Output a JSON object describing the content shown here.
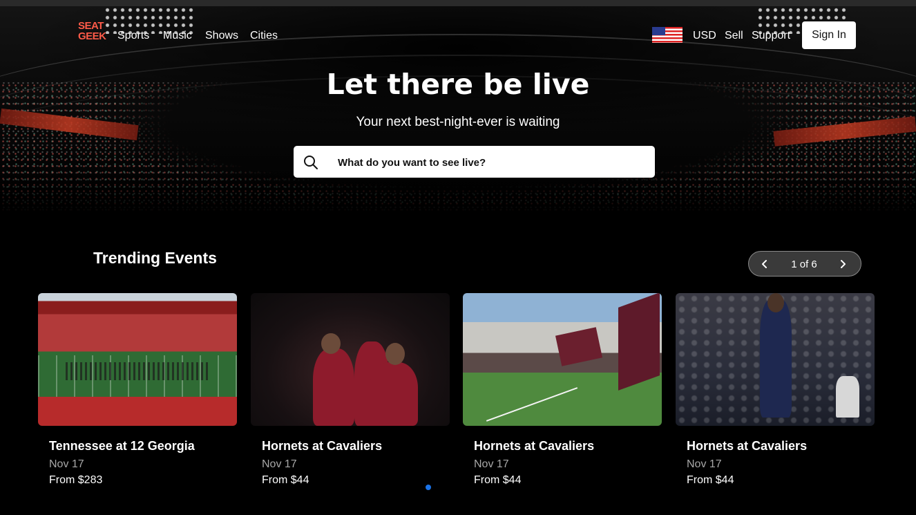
{
  "brand": {
    "logo_line1": "SEAT",
    "logo_line2": "GEEK",
    "accent": "#ff5b49"
  },
  "nav": {
    "links": [
      "Sports",
      "Music",
      "Shows",
      "Cities"
    ],
    "currency": "USD",
    "sell": "Sell",
    "support": "Support",
    "sign_in": "Sign In",
    "flag_icon": "us-flag-icon"
  },
  "hero": {
    "title": "Let there be live",
    "subtitle": "Your next best-night-ever is waiting",
    "search_placeholder": "What do you want to see live?"
  },
  "trending": {
    "title": "Trending Events",
    "pager": "1 of 6",
    "events": [
      {
        "title": "Tennessee at 12 Georgia",
        "date": "Nov 17",
        "price": "From $283"
      },
      {
        "title": "Hornets at Cavaliers",
        "date": "Nov 17",
        "price": "From $44"
      },
      {
        "title": "Hornets at Cavaliers",
        "date": "Nov 17",
        "price": "From $44"
      },
      {
        "title": "Hornets at Cavaliers",
        "date": "Nov 17",
        "price": "From $44"
      }
    ]
  },
  "colors": {
    "background": "#000000",
    "search_bg": "#ffffff",
    "dot": "#1a73e8"
  }
}
